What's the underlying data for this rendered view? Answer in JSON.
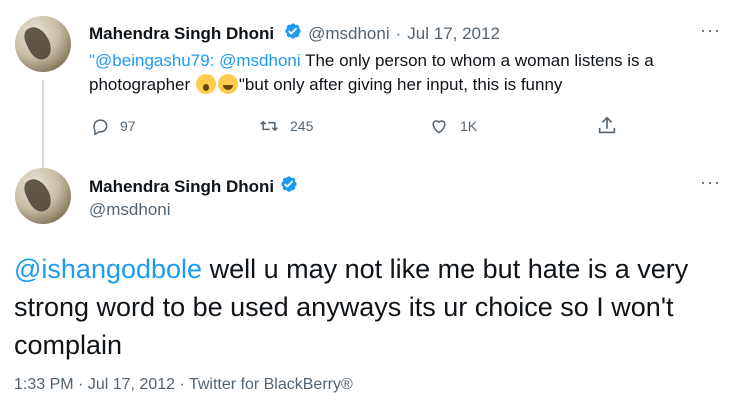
{
  "reply_tweet": {
    "author_name": "Mahendra Singh Dhoni",
    "handle": "@msdhoni",
    "separator": "·",
    "date": "Jul 17, 2012",
    "more": "···",
    "text_quote_open": "\"",
    "mention_1": "@beingashu79:",
    "mention_2": "@msdhoni",
    "text_line1_rest": " The only person to whom a woman listens is a",
    "text_line2_start": "photographer ",
    "text_line2_rest": "\"but only after giving her input, this is funny",
    "emoji_1": "face-screaming-in-fear",
    "emoji_2": "grinning-face",
    "actions": {
      "replies": "97",
      "retweets": "245",
      "likes": "1K"
    }
  },
  "main_tweet": {
    "author_name": "Mahendra Singh Dhoni",
    "handle": "@msdhoni",
    "more": "···",
    "mention": "@ishangodbole",
    "text": " well u may not like me but hate is a very strong word to be used anyways its ur choice so I won't complain",
    "time": "1:33 PM",
    "separator": "·",
    "date": "Jul 17, 2012",
    "source": "Twitter for BlackBerry®"
  },
  "colors": {
    "accent": "#1d9bf0",
    "text": "#0f1419",
    "muted": "#536471"
  }
}
